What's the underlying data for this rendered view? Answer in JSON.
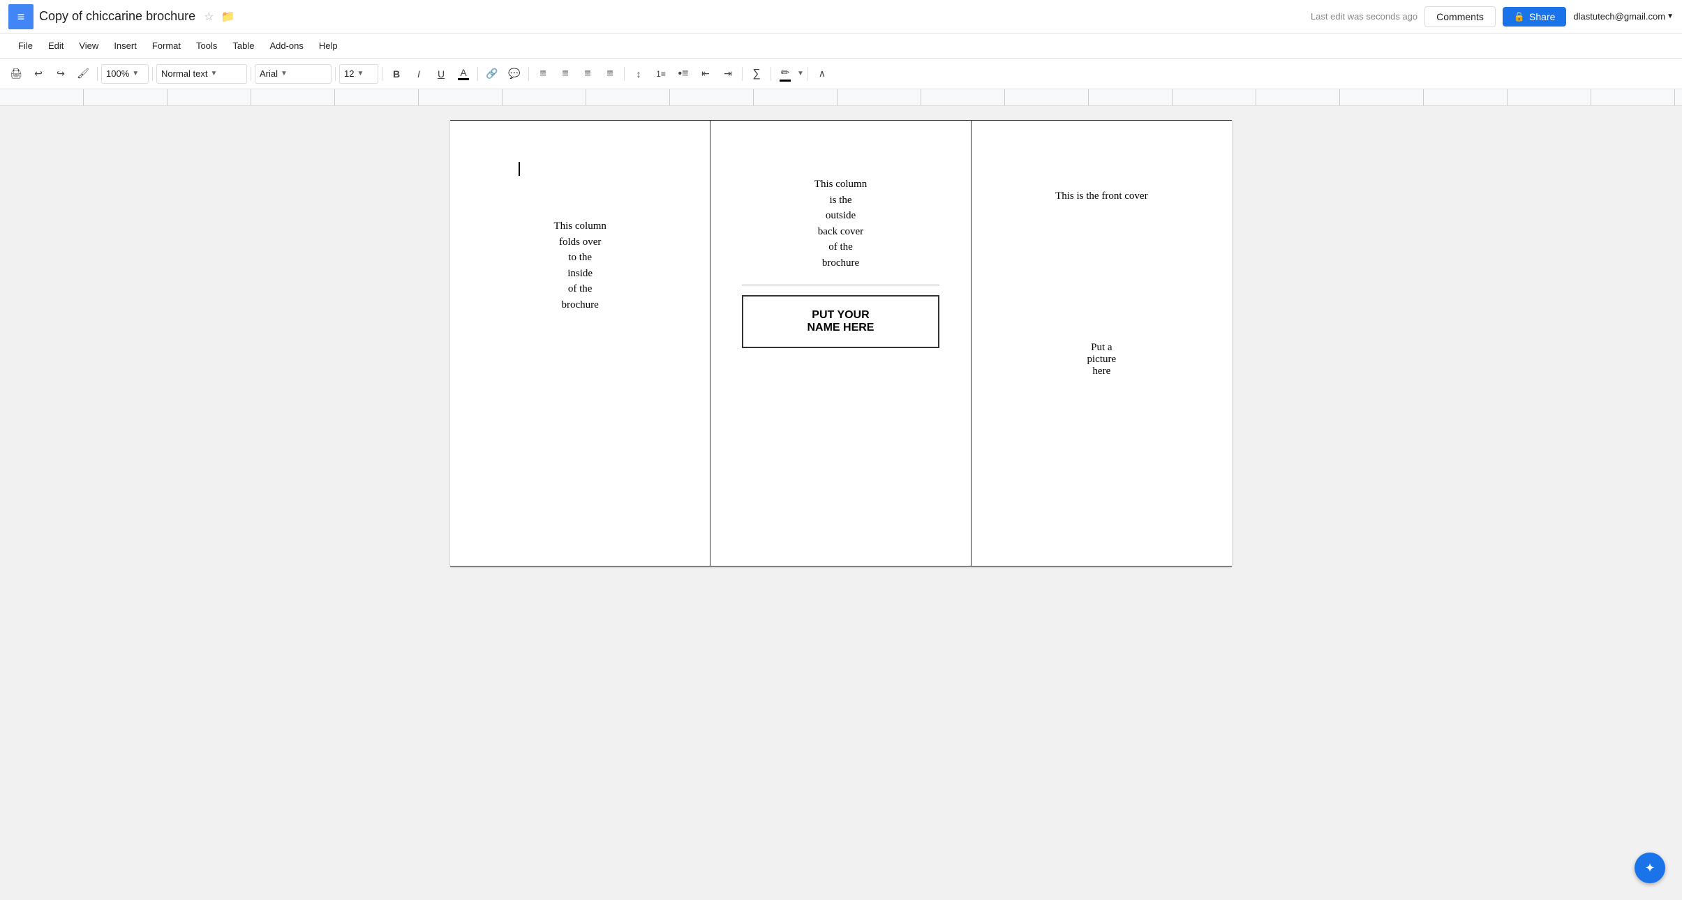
{
  "app": {
    "icon_label": "≡",
    "title": "Copy of chiccarine brochure",
    "star": "☆",
    "folder": "📁"
  },
  "header": {
    "last_edit": "Last edit was seconds ago",
    "comments_label": "Comments",
    "share_label": "Share",
    "user_email": "dlastutech@gmail.com"
  },
  "menu": {
    "items": [
      "File",
      "Edit",
      "View",
      "Insert",
      "Format",
      "Tools",
      "Table",
      "Add-ons",
      "Help"
    ]
  },
  "toolbar": {
    "zoom": "100%",
    "style": "Normal text",
    "font": "Arial",
    "size": "12",
    "print_label": "🖨",
    "undo_label": "↩",
    "redo_label": "↪"
  },
  "document": {
    "col1_text": "This column\nfolds over\nto the\ninside\nof the\nbrochure",
    "col2_top_text": "This column\nis the\noutside\nback cover\nof the\nbrochure",
    "col2_name_box": "PUT YOUR\nNAME HERE",
    "col3_front_text": "This is the front cover",
    "col3_picture_text": "Put a\npicture\nhere"
  }
}
